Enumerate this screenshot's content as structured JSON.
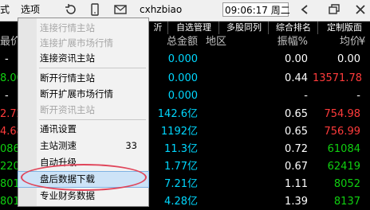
{
  "titlebar": {
    "menu_left": "式",
    "menu_options": "选项",
    "username": "cxhzbiao",
    "time": "09:06:17 周二",
    "icons": [
      "refresh-icon",
      "phone-icon",
      "mail-icon",
      "back-icon",
      "restore-icon",
      "close-icon"
    ]
  },
  "tabs": [
    "沂",
    "自选管理",
    "多股同列",
    "综合排名",
    "定制版面"
  ],
  "columns": {
    "left": "最价",
    "amount": "总金额",
    "region": "地区",
    "amplitude": "振幅%",
    "avg": "均价"
  },
  "rows": [
    {
      "left": "-",
      "amount": "0.000",
      "amp": "0.00",
      "avg": "0.00"
    },
    {
      "left": "8.00",
      "amount": "0.000",
      "amp": "0.44",
      "avg": "13571.78"
    },
    {
      "left": "-",
      "amount": "0.000",
      "amp": "-",
      "avg": "-"
    },
    {
      "left": "2.72",
      "amount": "142.6亿",
      "amp": "0.65",
      "avg": "754.98"
    },
    {
      "left": "4.68",
      "amount": "1192亿",
      "amp": "0.65",
      "avg": "756.99"
    },
    {
      "left": "0860",
      "amount": "11.3亿",
      "amp": "0.72",
      "avg": "61084"
    },
    {
      "left": "2200",
      "amount": "1.77亿",
      "amp": "0.67",
      "avg": "62419"
    },
    {
      "left": "8015",
      "amount": "7.21亿",
      "amp": "1.11",
      "avg": "8052"
    },
    {
      "left": "8015",
      "amount": "4.28亿",
      "amp": "1.39",
      "avg": "8137"
    }
  ],
  "menu": {
    "items": [
      {
        "label": "连接行情主站",
        "disabled": true
      },
      {
        "label": "连接扩展市场行情",
        "disabled": true
      },
      {
        "label": "连接资讯主站",
        "disabled": false
      },
      {
        "label": "断开行情主站",
        "disabled": false
      },
      {
        "label": "断开扩展市场行情",
        "disabled": false
      },
      {
        "label": "断开资讯主站",
        "disabled": true
      },
      {
        "label": "通讯设置",
        "disabled": false
      },
      {
        "label": "主站测速",
        "disabled": false,
        "extra": "33"
      },
      {
        "label": "自动升级",
        "disabled": false
      },
      {
        "label": "盘后数据下载",
        "disabled": false,
        "highlighted": true
      },
      {
        "label": "专业财务数据",
        "disabled": false
      }
    ]
  },
  "colors": {
    "cyan": "#00d8ff",
    "red": "#ff3b3b",
    "highlight": "#cde3f7",
    "oval": "#e0455a"
  }
}
